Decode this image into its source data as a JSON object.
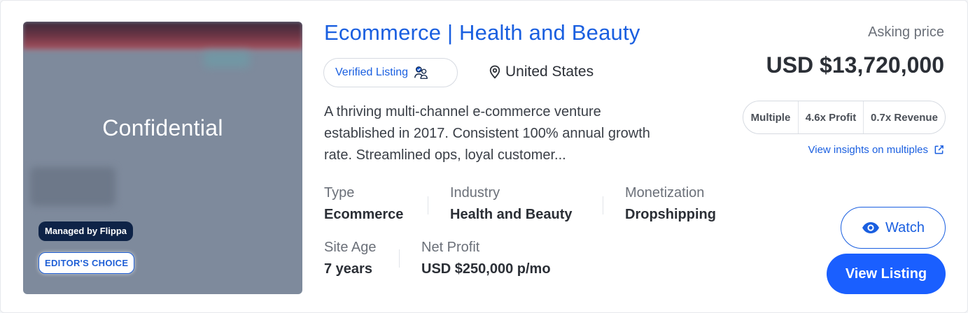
{
  "thumbnail": {
    "title": "Confidential",
    "managed_badge": "Managed by Flippa",
    "editor_badge": "EDITOR'S CHOICE"
  },
  "listing": {
    "title": "Ecommerce | Health and Beauty",
    "verified_label": "Verified Listing",
    "location": "United States",
    "description": "A thriving multi-channel e-commerce venture established in 2017. Consistent 100% annual growth rate. Streamlined ops, loyal customer...",
    "stats": {
      "type": {
        "label": "Type",
        "value": "Ecommerce"
      },
      "industry": {
        "label": "Industry",
        "value": "Health and Beauty"
      },
      "monetization": {
        "label": "Monetization",
        "value": "Dropshipping"
      },
      "site_age": {
        "label": "Site Age",
        "value": "7 years"
      },
      "net_profit": {
        "label": "Net Profit",
        "value": "USD $250,000 p/mo"
      }
    }
  },
  "pricing": {
    "asking_label": "Asking price",
    "asking_price": "USD $13,720,000",
    "multiples": [
      "Multiple",
      "4.6x Profit",
      "0.7x Revenue"
    ],
    "insights_link": "View insights on multiples"
  },
  "actions": {
    "watch_label": "Watch",
    "view_label": "View Listing"
  },
  "colors": {
    "accent": "#1a5fe0",
    "button_primary": "#1a5fff",
    "badge_dark": "#0e2347",
    "text": "#2b2f36"
  },
  "icons": {
    "verified": "verified-users-icon",
    "location": "map-pin-icon",
    "external": "external-link-icon",
    "watch": "eye-icon"
  }
}
